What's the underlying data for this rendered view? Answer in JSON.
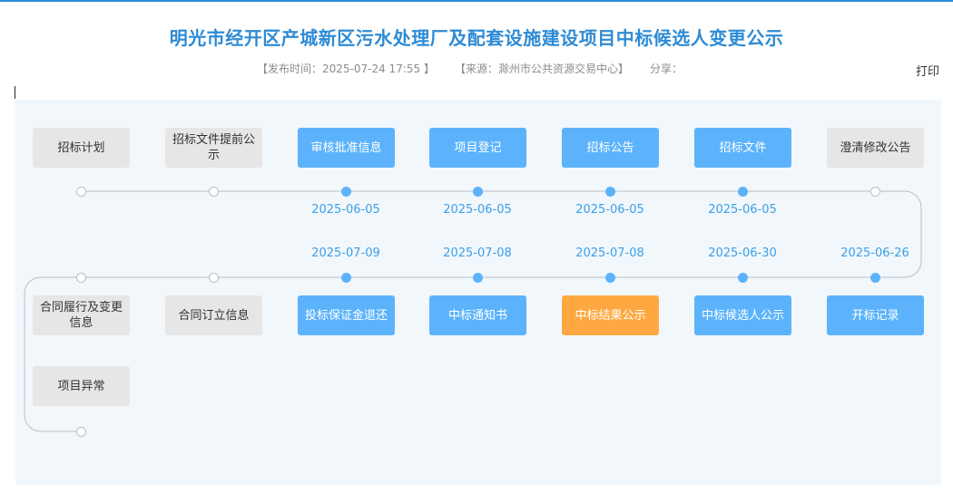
{
  "header": {
    "title": "明光市经开区产城新区污水处理厂及配套设施建设项目中标候选人变更公示",
    "publish_time": "【发布时间：2025-07-24 17:55 】",
    "source": "【来源：滁州市公共资源交易中心】",
    "share_label": "分享：",
    "print_label": "打印"
  },
  "timeline": {
    "row1": [
      {
        "label": "招标计划",
        "state": "inactive",
        "date": ""
      },
      {
        "label": "招标文件提前公示",
        "state": "inactive",
        "date": ""
      },
      {
        "label": "审核批准信息",
        "state": "done",
        "date": "2025-06-05"
      },
      {
        "label": "项目登记",
        "state": "done",
        "date": "2025-06-05"
      },
      {
        "label": "招标公告",
        "state": "done",
        "date": "2025-06-05"
      },
      {
        "label": "招标文件",
        "state": "done",
        "date": "2025-06-05"
      },
      {
        "label": "澄清修改公告",
        "state": "inactive",
        "date": ""
      }
    ],
    "row2": [
      {
        "label": "合同履行及变更信息",
        "state": "inactive",
        "date": ""
      },
      {
        "label": "合同订立信息",
        "state": "inactive",
        "date": ""
      },
      {
        "label": "投标保证金退还",
        "state": "done",
        "date": "2025-07-09"
      },
      {
        "label": "中标通知书",
        "state": "done",
        "date": "2025-07-08"
      },
      {
        "label": "中标结果公示",
        "state": "current",
        "date": "2025-07-08"
      },
      {
        "label": "中标候选人公示",
        "state": "done",
        "date": "2025-06-30"
      },
      {
        "label": "开标记录",
        "state": "done",
        "date": "2025-06-26"
      }
    ],
    "row3": [
      {
        "label": "项目异常",
        "state": "inactive",
        "date": ""
      }
    ]
  }
}
